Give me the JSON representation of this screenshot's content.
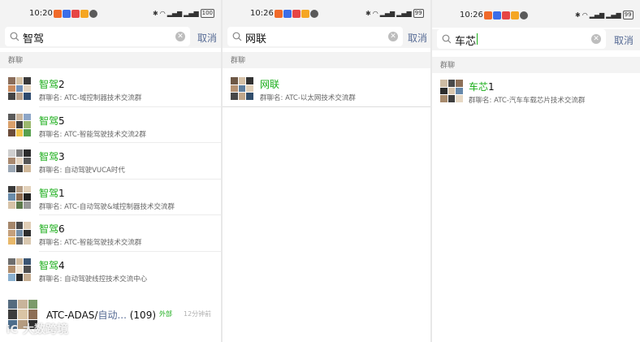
{
  "panels": [
    {
      "status": {
        "time": "10:20",
        "battery": "100"
      },
      "search": {
        "query": "智驾",
        "cancel": "取消"
      },
      "section_label": "群聊",
      "results": [
        {
          "hl": "智驾",
          "rest": "2",
          "desc": "群聊名: ATC-域控制器技术交流群"
        },
        {
          "hl": "智驾",
          "rest": "5",
          "desc": "群聊名: ATC-智能驾驶技术交流2群"
        },
        {
          "hl": "智驾",
          "rest": "3",
          "desc": "群聊名: 自动驾驶VUCA时代"
        },
        {
          "hl": "智驾",
          "rest": "1",
          "desc": "群聊名: ATC-自动驾驶&域控制器技术交流群"
        },
        {
          "hl": "智驾",
          "rest": "6",
          "desc": "群聊名: ATC-智能驾驶技术交流群"
        },
        {
          "hl": "智驾",
          "rest": "4",
          "desc": "群聊名: 自动驾驶线控技术交流中心"
        }
      ],
      "bottom": {
        "prefix": "ATC-ADAS/",
        "hl": "自动...",
        "count": " (109)",
        "tag": "外部",
        "time": "12分钟前"
      }
    },
    {
      "status": {
        "time": "10:26",
        "battery": "99"
      },
      "search": {
        "query": "网联",
        "cancel": "取消"
      },
      "section_label": "群聊",
      "results": [
        {
          "hl": "网联",
          "rest": "",
          "desc": "群聊名: ATC-以太网技术交流群"
        }
      ]
    },
    {
      "status": {
        "time": "10:26",
        "battery": "99"
      },
      "search": {
        "query": "车芯",
        "cancel": "取消"
      },
      "section_label": "群聊",
      "results": [
        {
          "hl": "车芯",
          "rest": "1",
          "desc": "群聊名: ATC-汽车车载芯片技术交流群"
        }
      ]
    }
  ],
  "watermark": {
    "logo": "iC",
    "text": "大数跨境"
  },
  "colors": {
    "accent_green": "#1aad19",
    "link_blue": "#576b95",
    "bg_gray": "#f3f3f3"
  }
}
